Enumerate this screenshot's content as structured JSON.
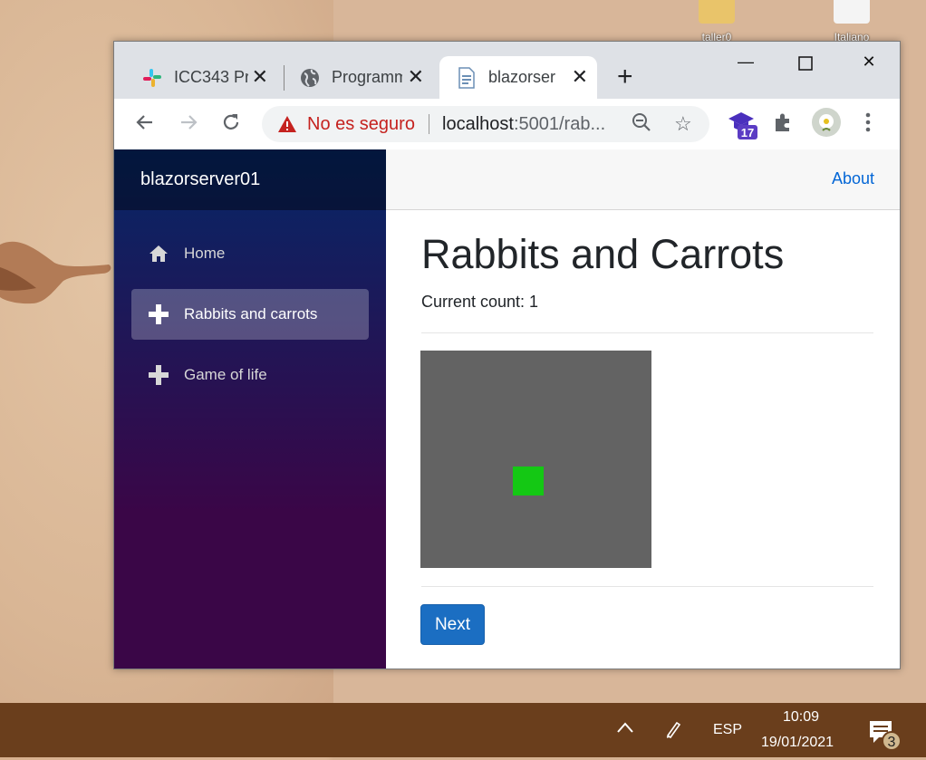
{
  "desktop": {
    "icons": [
      {
        "label": "taller0"
      },
      {
        "label": "Italiano"
      }
    ]
  },
  "browser": {
    "tabs": [
      {
        "title": "ICC343 Pr",
        "icon": "slack-icon"
      },
      {
        "title": "Programm",
        "icon": "globe-icon"
      },
      {
        "title": "blazorser",
        "icon": "page-icon",
        "active": true
      }
    ],
    "new_tab": "+",
    "security_label": "No es seguro",
    "url_host": "localhost",
    "url_rest": ":5001/rab...",
    "extension_badge": "17"
  },
  "app": {
    "brand": "blazorserver01",
    "nav": [
      {
        "label": "Home",
        "icon": "home-icon"
      },
      {
        "label": "Rabbits and carrots",
        "icon": "plus-icon",
        "active": true
      },
      {
        "label": "Game of life",
        "icon": "plus-icon"
      }
    ],
    "top_link": "About",
    "title": "Rabbits and Carrots",
    "count_label": "Current count: 1",
    "next_button": "Next",
    "grid": {
      "background": "#636363",
      "cell_color": "#14c814"
    }
  },
  "taskbar": {
    "language": "ESP",
    "time": "10:09",
    "date": "19/01/2021",
    "notification_count": "3"
  }
}
